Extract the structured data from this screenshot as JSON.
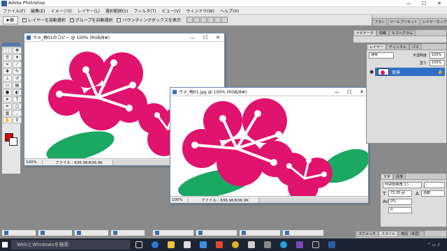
{
  "app": {
    "title": "Adobe Photoshop",
    "minimize": "—",
    "maximize": "☐",
    "close": "✕"
  },
  "menu": [
    "ファイル(F)",
    "編集(E)",
    "イメージ(I)",
    "レイヤー(L)",
    "選択範囲(S)",
    "フィルタ(T)",
    "ビュー(V)",
    "ウィンドウ(W)",
    "ヘルプ(H)"
  ],
  "options": {
    "tool_glyph": "▸⊕",
    "auto_select_layer": "レイヤーを自動選択",
    "auto_select_group": "グループを自動選択",
    "bounding_box": "バウンディングボックスを表示"
  },
  "palette_well": [
    "ブラシ",
    "ツールプリセット",
    "レイヤーカンプ"
  ],
  "doc_back": {
    "title": "ウメ_梅01のコピー @ 100% (RGB/8#)",
    "zoom": "100%",
    "file_info": "ファイル : 636.9K/636.9K"
  },
  "doc_front": {
    "title": "ウメ_梅01.jpg @ 100% (RGB/8#)",
    "zoom": "100%",
    "file_info": "ファイル : 636.9K/636.9K"
  },
  "navigator_tabs": [
    "ナビゲータ",
    "情報",
    "ヒストグラム"
  ],
  "layers_panel": {
    "tabs": [
      "レイヤー",
      "チャンネル",
      "パス"
    ],
    "blend_mode": "通常",
    "opacity_label": "不透明度",
    "opacity_value": "100%",
    "fill_label": "塗り",
    "fill_value": "100%",
    "layer_name": "背景",
    "lock_icon": "🔒"
  },
  "character_panel": {
    "tabs": [
      "文字",
      "段落"
    ],
    "font_family": "HGP創英角ゴシ...",
    "font_style": "-",
    "font_size": "72.35 pt",
    "leading": "自動",
    "tracking": "0%",
    "kerning": "0",
    "bottom_tabs": [
      "スウォッチ",
      "スタイル"
    ],
    "language": "英語（米国）"
  },
  "minimized_docs": [
    "",
    "",
    "",
    "",
    "",
    "",
    "",
    ""
  ],
  "taskbar": {
    "search_placeholder": "WebとWindowsを検索",
    "time": ""
  },
  "colors": {
    "flower": "#e0136f",
    "leaf": "#1aa862",
    "foreground": "#e00000",
    "background": "#ffffff"
  }
}
